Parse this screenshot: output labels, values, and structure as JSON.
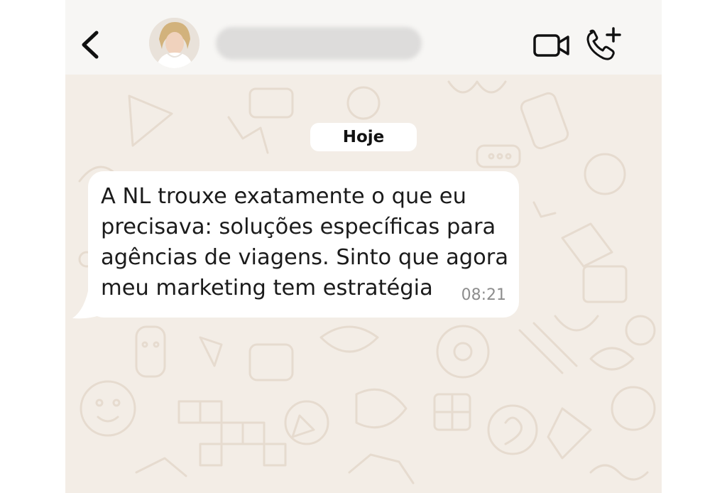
{
  "chat": {
    "date_label": "Hoje",
    "message": {
      "lines": [
        "A NL trouxe exatamente o que eu",
        "precisava: soluções específicas para",
        "agências de viagens. Sinto que agora",
        "meu marketing tem estratégia"
      ],
      "time": "08:21"
    }
  },
  "header": {
    "icons": [
      "chevron-left-icon",
      "video-camera-icon",
      "phone-add-icon"
    ]
  },
  "colors": {
    "wallpaper": "#f3ede6",
    "header": "#f7f6f4",
    "bubble": "#ffffff",
    "timestamp": "#8d8d8d"
  }
}
